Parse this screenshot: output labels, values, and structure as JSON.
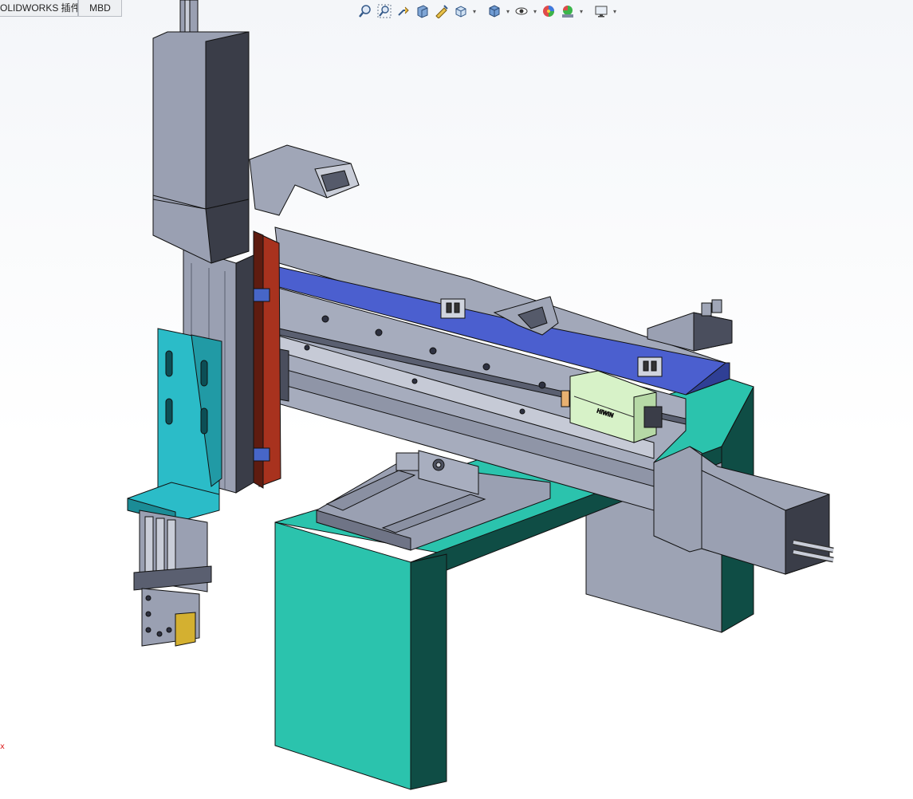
{
  "tabs": [
    {
      "label": "OLIDWORKS 插件"
    },
    {
      "label": "MBD"
    }
  ],
  "toolbar": {
    "icons": [
      "zoom-to-fit-icon",
      "zoom-to-area-icon",
      "previous-view-icon",
      "section-view-icon",
      "dynamic-annotation-icon",
      "view-orientation-icon",
      "display-style-icon",
      "hide-show-items-icon",
      "edit-appearance-icon",
      "apply-scene-icon",
      "view-settings-icon"
    ]
  },
  "triad": {
    "label": "x"
  },
  "colors": {
    "base_front": "#2bc3ad",
    "base_side": "#0f4d45",
    "steel": "#9aa0b2",
    "steel_dark": "#3a3d48",
    "blue_plate": "#4b5fcf",
    "bracket_cyan": "#2bbcc8",
    "brown_plate": "#a8321e",
    "slider_green": "#d7f2c8"
  }
}
